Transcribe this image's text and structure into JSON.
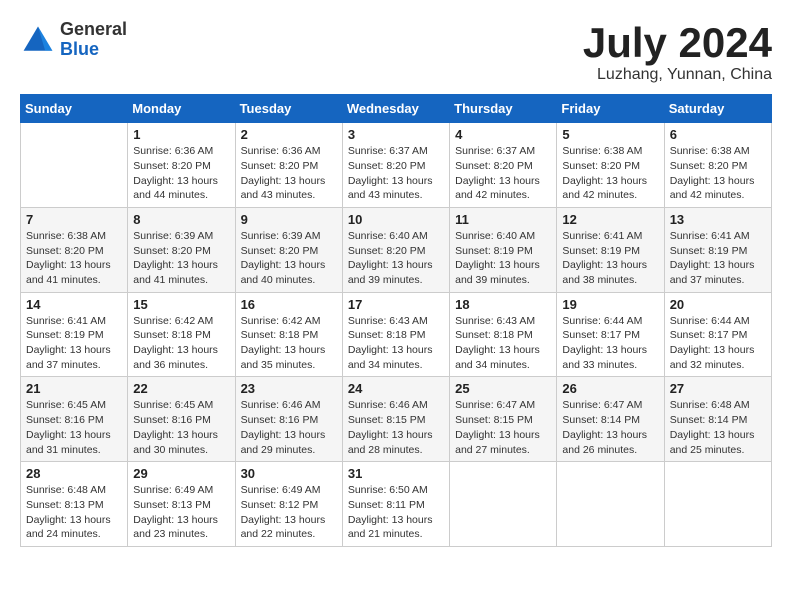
{
  "logo": {
    "general": "General",
    "blue": "Blue"
  },
  "header": {
    "month_year": "July 2024",
    "location": "Luzhang, Yunnan, China"
  },
  "weekdays": [
    "Sunday",
    "Monday",
    "Tuesday",
    "Wednesday",
    "Thursday",
    "Friday",
    "Saturday"
  ],
  "weeks": [
    [
      {
        "day": "",
        "info": ""
      },
      {
        "day": "1",
        "info": "Sunrise: 6:36 AM\nSunset: 8:20 PM\nDaylight: 13 hours\nand 44 minutes."
      },
      {
        "day": "2",
        "info": "Sunrise: 6:36 AM\nSunset: 8:20 PM\nDaylight: 13 hours\nand 43 minutes."
      },
      {
        "day": "3",
        "info": "Sunrise: 6:37 AM\nSunset: 8:20 PM\nDaylight: 13 hours\nand 43 minutes."
      },
      {
        "day": "4",
        "info": "Sunrise: 6:37 AM\nSunset: 8:20 PM\nDaylight: 13 hours\nand 42 minutes."
      },
      {
        "day": "5",
        "info": "Sunrise: 6:38 AM\nSunset: 8:20 PM\nDaylight: 13 hours\nand 42 minutes."
      },
      {
        "day": "6",
        "info": "Sunrise: 6:38 AM\nSunset: 8:20 PM\nDaylight: 13 hours\nand 42 minutes."
      }
    ],
    [
      {
        "day": "7",
        "info": "Sunrise: 6:38 AM\nSunset: 8:20 PM\nDaylight: 13 hours\nand 41 minutes."
      },
      {
        "day": "8",
        "info": "Sunrise: 6:39 AM\nSunset: 8:20 PM\nDaylight: 13 hours\nand 41 minutes."
      },
      {
        "day": "9",
        "info": "Sunrise: 6:39 AM\nSunset: 8:20 PM\nDaylight: 13 hours\nand 40 minutes."
      },
      {
        "day": "10",
        "info": "Sunrise: 6:40 AM\nSunset: 8:20 PM\nDaylight: 13 hours\nand 39 minutes."
      },
      {
        "day": "11",
        "info": "Sunrise: 6:40 AM\nSunset: 8:19 PM\nDaylight: 13 hours\nand 39 minutes."
      },
      {
        "day": "12",
        "info": "Sunrise: 6:41 AM\nSunset: 8:19 PM\nDaylight: 13 hours\nand 38 minutes."
      },
      {
        "day": "13",
        "info": "Sunrise: 6:41 AM\nSunset: 8:19 PM\nDaylight: 13 hours\nand 37 minutes."
      }
    ],
    [
      {
        "day": "14",
        "info": "Sunrise: 6:41 AM\nSunset: 8:19 PM\nDaylight: 13 hours\nand 37 minutes."
      },
      {
        "day": "15",
        "info": "Sunrise: 6:42 AM\nSunset: 8:18 PM\nDaylight: 13 hours\nand 36 minutes."
      },
      {
        "day": "16",
        "info": "Sunrise: 6:42 AM\nSunset: 8:18 PM\nDaylight: 13 hours\nand 35 minutes."
      },
      {
        "day": "17",
        "info": "Sunrise: 6:43 AM\nSunset: 8:18 PM\nDaylight: 13 hours\nand 34 minutes."
      },
      {
        "day": "18",
        "info": "Sunrise: 6:43 AM\nSunset: 8:18 PM\nDaylight: 13 hours\nand 34 minutes."
      },
      {
        "day": "19",
        "info": "Sunrise: 6:44 AM\nSunset: 8:17 PM\nDaylight: 13 hours\nand 33 minutes."
      },
      {
        "day": "20",
        "info": "Sunrise: 6:44 AM\nSunset: 8:17 PM\nDaylight: 13 hours\nand 32 minutes."
      }
    ],
    [
      {
        "day": "21",
        "info": "Sunrise: 6:45 AM\nSunset: 8:16 PM\nDaylight: 13 hours\nand 31 minutes."
      },
      {
        "day": "22",
        "info": "Sunrise: 6:45 AM\nSunset: 8:16 PM\nDaylight: 13 hours\nand 30 minutes."
      },
      {
        "day": "23",
        "info": "Sunrise: 6:46 AM\nSunset: 8:16 PM\nDaylight: 13 hours\nand 29 minutes."
      },
      {
        "day": "24",
        "info": "Sunrise: 6:46 AM\nSunset: 8:15 PM\nDaylight: 13 hours\nand 28 minutes."
      },
      {
        "day": "25",
        "info": "Sunrise: 6:47 AM\nSunset: 8:15 PM\nDaylight: 13 hours\nand 27 minutes."
      },
      {
        "day": "26",
        "info": "Sunrise: 6:47 AM\nSunset: 8:14 PM\nDaylight: 13 hours\nand 26 minutes."
      },
      {
        "day": "27",
        "info": "Sunrise: 6:48 AM\nSunset: 8:14 PM\nDaylight: 13 hours\nand 25 minutes."
      }
    ],
    [
      {
        "day": "28",
        "info": "Sunrise: 6:48 AM\nSunset: 8:13 PM\nDaylight: 13 hours\nand 24 minutes."
      },
      {
        "day": "29",
        "info": "Sunrise: 6:49 AM\nSunset: 8:13 PM\nDaylight: 13 hours\nand 23 minutes."
      },
      {
        "day": "30",
        "info": "Sunrise: 6:49 AM\nSunset: 8:12 PM\nDaylight: 13 hours\nand 22 minutes."
      },
      {
        "day": "31",
        "info": "Sunrise: 6:50 AM\nSunset: 8:11 PM\nDaylight: 13 hours\nand 21 minutes."
      },
      {
        "day": "",
        "info": ""
      },
      {
        "day": "",
        "info": ""
      },
      {
        "day": "",
        "info": ""
      }
    ]
  ]
}
